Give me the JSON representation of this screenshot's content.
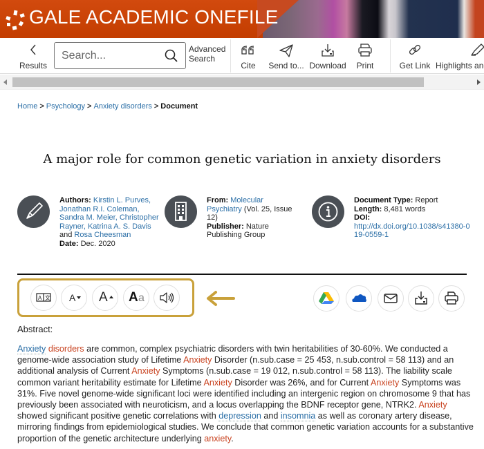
{
  "header": {
    "brand": "GALE ACADEMIC ONEFILE",
    "brand_color": "#c43d00"
  },
  "toolbar": {
    "results_label": "Results",
    "search_placeholder": "Search...",
    "advanced_search_line1": "Advanced",
    "advanced_search_line2": "Search",
    "items": [
      {
        "label": "Cite",
        "icon": "quote-icon"
      },
      {
        "label": "Send to...",
        "icon": "paper-plane-icon"
      },
      {
        "label": "Download",
        "icon": "download-icon"
      },
      {
        "label": "Print",
        "icon": "printer-icon"
      },
      {
        "label": "Get Link",
        "icon": "link-icon"
      },
      {
        "label": "Highlights and",
        "icon": "highlighter-icon"
      }
    ]
  },
  "breadcrumb": {
    "items": [
      "Home",
      "Psychology",
      "Anxiety disorders"
    ],
    "current": "Document",
    "separator": ">"
  },
  "document": {
    "title": "A major role for common genetic variation in anxiety disorders",
    "authors_label": "Authors:",
    "authors_linked": "Kirstin L. Purves, Jonathan R.I. Coleman, Sandra M. Meier, Christopher Rayner, Katrina A. S. Davis",
    "authors_and": "and",
    "authors_last": "Rosa Cheesman",
    "date_label": "Date:",
    "date": "Dec. 2020",
    "from_label": "From:",
    "from_journal": "Molecular Psychiatry",
    "from_issue": "(Vol. 25, Issue 12)",
    "publisher_label": "Publisher:",
    "publisher": "Nature Publishing Group",
    "doctype_label": "Document Type:",
    "doctype": "Report",
    "length_label": "Length:",
    "length": "8,481 words",
    "doi_label": "DOI:",
    "doi": "http://dx.doi.org/10.1038/s41380-019-0559-1"
  },
  "reader_tools": [
    {
      "name": "translate",
      "icon": "translate-icon"
    },
    {
      "name": "decrease-font",
      "icon": "font-decrease-icon",
      "glyph": "A"
    },
    {
      "name": "increase-font",
      "icon": "font-increase-icon",
      "glyph": "A"
    },
    {
      "name": "font-style",
      "icon": "font-style-icon",
      "glyph_bold": "A",
      "glyph_light": "a"
    },
    {
      "name": "listen",
      "icon": "speaker-icon"
    }
  ],
  "share_tools": [
    {
      "name": "google-drive",
      "icon": "google-drive-icon"
    },
    {
      "name": "onedrive",
      "icon": "onedrive-icon"
    },
    {
      "name": "email",
      "icon": "envelope-icon"
    },
    {
      "name": "download",
      "icon": "download-icon"
    },
    {
      "name": "print",
      "icon": "printer-icon"
    }
  ],
  "highlight_color": "#c9a13a",
  "abstract": {
    "label": "Abstract:",
    "segments": [
      {
        "t": "Anxiety",
        "k": "lk"
      },
      {
        "t": " ",
        "k": ""
      },
      {
        "t": "disorders",
        "k": "hl"
      },
      {
        "t": " are common, complex psychiatric disorders with twin heritabilities of 30-60%. We conducted a genome-wide association study of Lifetime ",
        "k": ""
      },
      {
        "t": "Anxiety",
        "k": "hl"
      },
      {
        "t": " Disorder (n.sub.case = 25 453, n.sub.control = 58 113) and an additional analysis of Current ",
        "k": ""
      },
      {
        "t": "Anxiety",
        "k": "hl"
      },
      {
        "t": " Symptoms (n.sub.case = 19 012, n.sub.control = 58 113). The liability scale common variant heritability estimate for Lifetime ",
        "k": ""
      },
      {
        "t": "Anxiety",
        "k": "hl"
      },
      {
        "t": " Disorder was 26%, and for Current ",
        "k": ""
      },
      {
        "t": "Anxiety",
        "k": "hl"
      },
      {
        "t": " Symptoms was 31%. Five novel genome-wide significant loci were identified including an intergenic region on chromosome 9 that has previously been associated with neuroticism, and a locus overlapping the BDNF receptor gene, NTRK2. ",
        "k": ""
      },
      {
        "t": "Anxiety",
        "k": "hl"
      },
      {
        "t": " showed significant positive genetic correlations with ",
        "k": ""
      },
      {
        "t": "depression",
        "k": "lk"
      },
      {
        "t": " and ",
        "k": ""
      },
      {
        "t": "insomnia",
        "k": "lk"
      },
      {
        "t": " as well as coronary artery disease, mirroring findings from epidemiological studies. We conclude that common genetic variation accounts for a substantive proportion of the genetic architecture underlying ",
        "k": ""
      },
      {
        "t": "anxiety",
        "k": "hl"
      },
      {
        "t": ".",
        "k": ""
      }
    ]
  }
}
